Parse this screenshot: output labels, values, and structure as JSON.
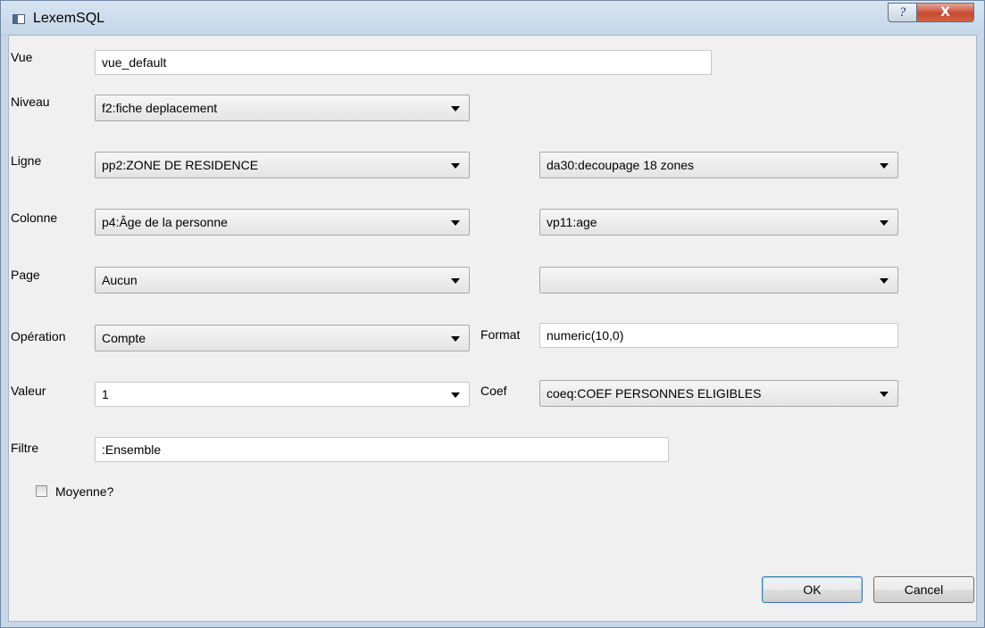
{
  "window": {
    "title": "LexemSQL",
    "help_glyph": "?",
    "close_glyph": "X"
  },
  "form": {
    "vue": {
      "label": "Vue",
      "value": "vue_default"
    },
    "niveau": {
      "label": "Niveau",
      "value": "f2:fiche deplacement"
    },
    "ligne": {
      "label": "Ligne",
      "value": "pp2:ZONE DE RESIDENCE",
      "value2": "da30:decoupage 18 zones"
    },
    "colonne": {
      "label": "Colonne",
      "value": "p4:Âge de la personne",
      "value2": "vp11:age"
    },
    "page": {
      "label": "Page",
      "value": "Aucun",
      "value2": ""
    },
    "operation": {
      "label": "Opération",
      "value": "Compte"
    },
    "format": {
      "label": "Format",
      "value": "numeric(10,0)"
    },
    "valeur": {
      "label": "Valeur",
      "value": "1"
    },
    "coef": {
      "label": "Coef",
      "value": "coeq:COEF PERSONNES ELIGIBLES"
    },
    "filtre": {
      "label": "Filtre",
      "value": ":Ensemble"
    },
    "moyenne": {
      "label": "Moyenne?",
      "checked": false
    }
  },
  "buttons": {
    "ok": "OK",
    "cancel": "Cancel"
  }
}
